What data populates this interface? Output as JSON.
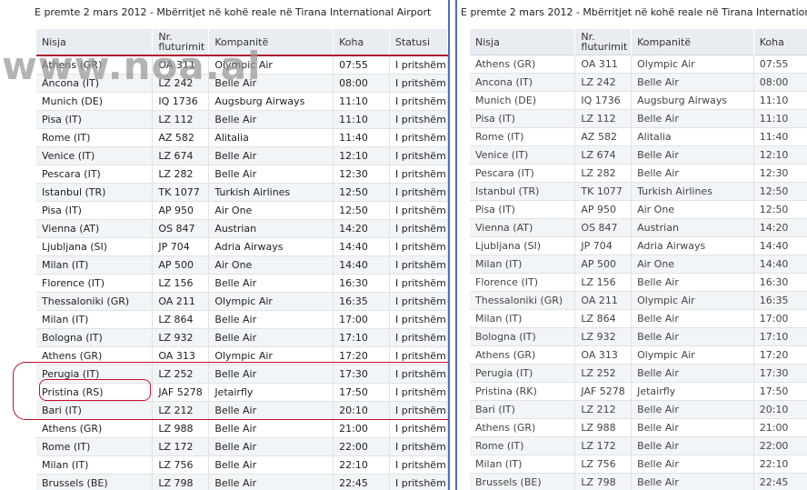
{
  "left": {
    "caption": "E premte 2 mars 2012 - Mbërritjet në kohë reale në Tirana International Airport",
    "headers": {
      "origin": "Nisja",
      "flight_line1": "Nr.",
      "flight_line2": "fluturimit",
      "airline": "Kompanitë",
      "time": "Koha",
      "status": "Statusi"
    },
    "rows": [
      {
        "origin": "Athens (GR)",
        "flight": "OA 311",
        "airline": "Olympic Air",
        "time": "07:55",
        "status": "I pritshëm"
      },
      {
        "origin": "Ancona (IT)",
        "flight": "LZ 242",
        "airline": "Belle Air",
        "time": "08:00",
        "status": "I pritshëm"
      },
      {
        "origin": "Munich (DE)",
        "flight": "IQ 1736",
        "airline": "Augsburg Airways",
        "time": "11:10",
        "status": "I pritshëm"
      },
      {
        "origin": "Pisa (IT)",
        "flight": "LZ 112",
        "airline": "Belle Air",
        "time": "11:10",
        "status": "I pritshëm"
      },
      {
        "origin": "Rome (IT)",
        "flight": "AZ 582",
        "airline": "Alitalia",
        "time": "11:40",
        "status": "I pritshëm"
      },
      {
        "origin": "Venice (IT)",
        "flight": "LZ 674",
        "airline": "Belle Air",
        "time": "12:10",
        "status": "I pritshëm"
      },
      {
        "origin": "Pescara (IT)",
        "flight": "LZ 282",
        "airline": "Belle Air",
        "time": "12:30",
        "status": "I pritshëm"
      },
      {
        "origin": "Istanbul (TR)",
        "flight": "TK 1077",
        "airline": "Turkish Airlines",
        "time": "12:50",
        "status": "I pritshëm"
      },
      {
        "origin": "Pisa (IT)",
        "flight": "AP 950",
        "airline": "Air One",
        "time": "12:50",
        "status": "I pritshëm"
      },
      {
        "origin": "Vienna (AT)",
        "flight": "OS 847",
        "airline": "Austrian",
        "time": "14:20",
        "status": "I pritshëm"
      },
      {
        "origin": "Ljubljana (SI)",
        "flight": "JP 704",
        "airline": "Adria Airways",
        "time": "14:40",
        "status": "I pritshëm"
      },
      {
        "origin": "Milan (IT)",
        "flight": "AP 500",
        "airline": "Air One",
        "time": "14:40",
        "status": "I pritshëm"
      },
      {
        "origin": "Florence (IT)",
        "flight": "LZ 156",
        "airline": "Belle Air",
        "time": "16:30",
        "status": "I pritshëm"
      },
      {
        "origin": "Thessaloniki (GR)",
        "flight": "OA 211",
        "airline": "Olympic Air",
        "time": "16:35",
        "status": "I pritshëm"
      },
      {
        "origin": "Milan (IT)",
        "flight": "LZ 864",
        "airline": "Belle Air",
        "time": "17:00",
        "status": "I pritshëm"
      },
      {
        "origin": "Bologna (IT)",
        "flight": "LZ 932",
        "airline": "Belle Air",
        "time": "17:10",
        "status": "I pritshëm"
      },
      {
        "origin": "Athens (GR)",
        "flight": "OA 313",
        "airline": "Olympic Air",
        "time": "17:20",
        "status": "I pritshëm"
      },
      {
        "origin": "Perugia (IT)",
        "flight": "LZ 252",
        "airline": "Belle Air",
        "time": "17:30",
        "status": "I pritshëm"
      },
      {
        "origin": "Pristina (RS)",
        "flight": "JAF 5278",
        "airline": "Jetairfly",
        "time": "17:50",
        "status": "I pritshëm"
      },
      {
        "origin": "Bari (IT)",
        "flight": "LZ 212",
        "airline": "Belle Air",
        "time": "20:10",
        "status": "I pritshëm"
      },
      {
        "origin": "Athens (GR)",
        "flight": "LZ 988",
        "airline": "Belle Air",
        "time": "21:00",
        "status": "I pritshëm"
      },
      {
        "origin": "Rome (IT)",
        "flight": "LZ 172",
        "airline": "Belle Air",
        "time": "22:00",
        "status": "I pritshëm"
      },
      {
        "origin": "Milan (IT)",
        "flight": "LZ 756",
        "airline": "Belle Air",
        "time": "22:10",
        "status": "I pritshëm"
      },
      {
        "origin": "Brussels (BE)",
        "flight": "LZ 798",
        "airline": "Belle Air",
        "time": "22:45",
        "status": "I pritshëm"
      }
    ]
  },
  "right": {
    "caption": "E premte 2 mars 2012 - Mbërritjet në kohë reale në Tirana International Airport",
    "headers": {
      "origin": "Nisja",
      "flight_line1": "Nr.",
      "flight_line2": "fluturimit",
      "airline": "Kompanitë",
      "time": "Koha"
    },
    "rows": [
      {
        "origin": "Athens (GR)",
        "flight": "OA 311",
        "airline": "Olympic Air",
        "time": "07:55"
      },
      {
        "origin": "Ancona (IT)",
        "flight": "LZ 242",
        "airline": "Belle Air",
        "time": "08:00"
      },
      {
        "origin": "Munich (DE)",
        "flight": "IQ 1736",
        "airline": "Augsburg Airways",
        "time": "11:10"
      },
      {
        "origin": "Pisa (IT)",
        "flight": "LZ 112",
        "airline": "Belle Air",
        "time": "11:10"
      },
      {
        "origin": "Rome (IT)",
        "flight": "AZ 582",
        "airline": "Alitalia",
        "time": "11:40"
      },
      {
        "origin": "Venice (IT)",
        "flight": "LZ 674",
        "airline": "Belle Air",
        "time": "12:10"
      },
      {
        "origin": "Pescara (IT)",
        "flight": "LZ 282",
        "airline": "Belle Air",
        "time": "12:30"
      },
      {
        "origin": "Istanbul (TR)",
        "flight": "TK 1077",
        "airline": "Turkish Airlines",
        "time": "12:50"
      },
      {
        "origin": "Pisa (IT)",
        "flight": "AP 950",
        "airline": "Air One",
        "time": "12:50"
      },
      {
        "origin": "Vienna (AT)",
        "flight": "OS 847",
        "airline": "Austrian",
        "time": "14:20"
      },
      {
        "origin": "Ljubljana (SI)",
        "flight": "JP 704",
        "airline": "Adria Airways",
        "time": "14:40"
      },
      {
        "origin": "Milan (IT)",
        "flight": "AP 500",
        "airline": "Air One",
        "time": "14:40"
      },
      {
        "origin": "Florence (IT)",
        "flight": "LZ 156",
        "airline": "Belle Air",
        "time": "16:30"
      },
      {
        "origin": "Thessaloniki (GR)",
        "flight": "OA 211",
        "airline": "Olympic Air",
        "time": "16:35"
      },
      {
        "origin": "Milan (IT)",
        "flight": "LZ 864",
        "airline": "Belle Air",
        "time": "17:00"
      },
      {
        "origin": "Bologna (IT)",
        "flight": "LZ 932",
        "airline": "Belle Air",
        "time": "17:10"
      },
      {
        "origin": "Athens (GR)",
        "flight": "OA 313",
        "airline": "Olympic Air",
        "time": "17:20"
      },
      {
        "origin": "Perugia (IT)",
        "flight": "LZ 252",
        "airline": "Belle Air",
        "time": "17:30"
      },
      {
        "origin": "Pristina (RK)",
        "flight": "JAF 5278",
        "airline": "Jetairfly",
        "time": "17:50"
      },
      {
        "origin": "Bari (IT)",
        "flight": "LZ 212",
        "airline": "Belle Air",
        "time": "20:10"
      },
      {
        "origin": "Athens (GR)",
        "flight": "LZ 988",
        "airline": "Belle Air",
        "time": "21:00"
      },
      {
        "origin": "Rome (IT)",
        "flight": "LZ 172",
        "airline": "Belle Air",
        "time": "22:00"
      },
      {
        "origin": "Milan (IT)",
        "flight": "LZ 756",
        "airline": "Belle Air",
        "time": "22:10"
      },
      {
        "origin": "Brussels (BE)",
        "flight": "LZ 798",
        "airline": "Belle Air",
        "time": "22:45"
      }
    ]
  },
  "watermark": "www.noa.al",
  "colors": {
    "accent_line": "#b01e2e",
    "divider": "#4a6fc0",
    "header_bg": "#e9edf1",
    "annotation": "#c8102e"
  }
}
